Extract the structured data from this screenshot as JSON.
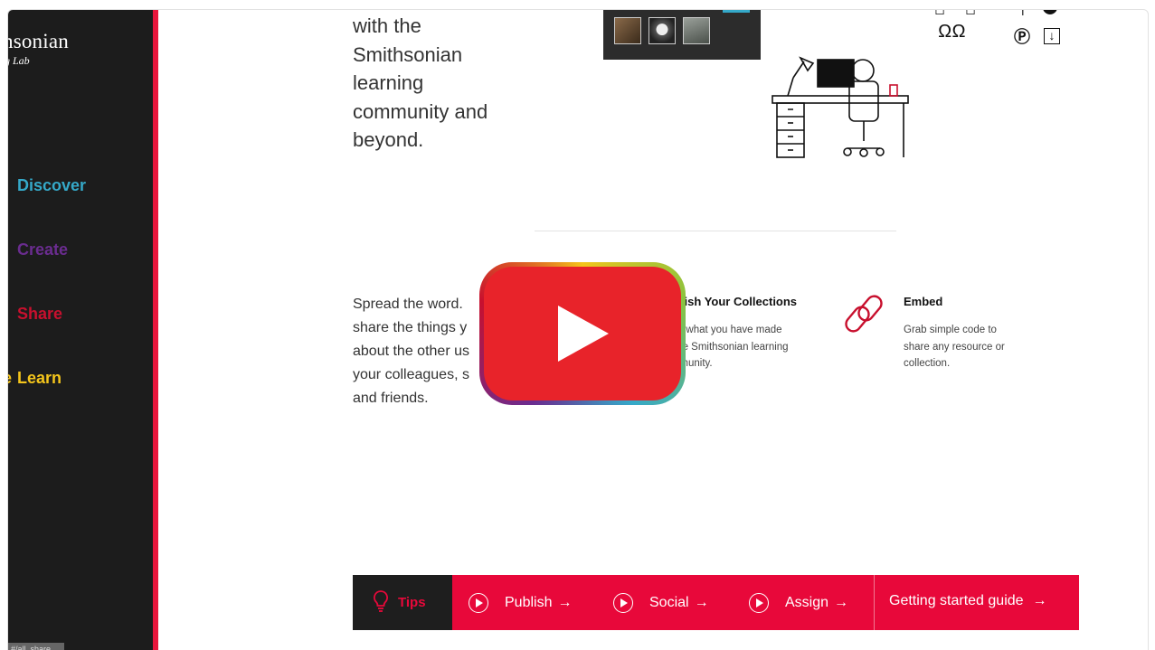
{
  "sidebar": {
    "logo_main": "hsonian",
    "logo_sub": "g Lab",
    "items": [
      {
        "label": "Discover"
      },
      {
        "label": "Create"
      },
      {
        "label": "Share"
      },
      {
        "label": "Learn"
      }
    ],
    "tooltip": "#/all_share"
  },
  "intro": {
    "lines": [
      "with the",
      "Smithsonian",
      "learning",
      "community and",
      "beyond."
    ]
  },
  "spread": {
    "lines": [
      "Spread the word.",
      "share the things y",
      "about the other us",
      "your colleagues, s",
      "and friends."
    ]
  },
  "features": {
    "publish": {
      "title": "blish Your Collections",
      "lines": [
        "re what you have made",
        "the Smithsonian learning",
        "nmunity."
      ]
    },
    "embed": {
      "title": "Embed",
      "lines": [
        "Grab simple code to",
        "share any resource or",
        "collection."
      ]
    }
  },
  "bottom_bar": {
    "tips": "Tips",
    "items": [
      {
        "label": "Publish"
      },
      {
        "label": "Social"
      },
      {
        "label": "Assign"
      }
    ],
    "guide": "Getting started guide"
  },
  "colors": {
    "discover": "#35a9c9",
    "create": "#6a2c8f",
    "share": "#c8102e",
    "learn": "#f4c51b",
    "accent": "#e8083a",
    "play": "#e8232a"
  }
}
